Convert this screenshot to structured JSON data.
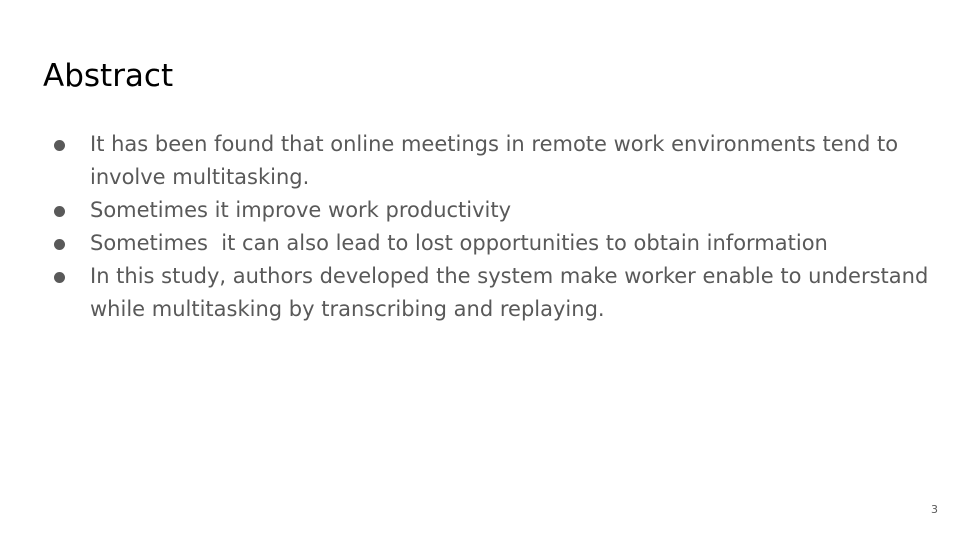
{
  "slide": {
    "title": "Abstract",
    "bullets": [
      {
        "text": "It has been found that online meetings in remote work environments tend to involve multitasking."
      },
      {
        "text": "Sometimes it improve work productivity"
      },
      {
        "text": "Sometimes  it can also lead to lost opportunities to obtain information"
      },
      {
        "text": "In this study, authors developed the system make worker enable to understand while multitasking by transcribing and replaying."
      }
    ],
    "page_number": "3"
  },
  "colors": {
    "background": "#ffffff",
    "title": "#000000",
    "body_text": "#595959"
  },
  "icons": {
    "bullet": "bullet-dot-icon"
  }
}
